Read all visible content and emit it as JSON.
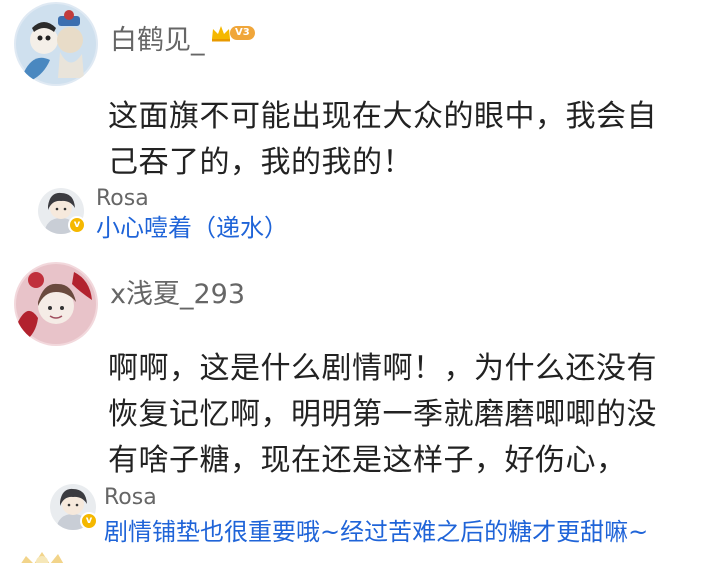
{
  "comments": [
    {
      "username": "白鹤见_",
      "level_badge": "V3",
      "text_lines": [
        "这面旗不可能出现在大众的眼中，我会自",
        "己吞了的，我的我的！"
      ],
      "reply": {
        "username": "Rosa",
        "text": "小心噎着（递水）"
      }
    },
    {
      "username": "x浅夏_293",
      "text_lines": [
        "啊啊，这是什么剧情啊！，为什么还没有",
        "恢复记忆啊，明明第一季就磨磨唧唧的没",
        "有啥子糖，现在还是这样子，好伤心，"
      ],
      "reply": {
        "username": "Rosa",
        "text": "剧情铺垫也很重要哦~经过苦难之后的糖才更甜嘛~"
      }
    }
  ],
  "icons": {
    "crown": "crown-icon",
    "verified": "verified-v-icon"
  },
  "colors": {
    "reply_link": "#1f64d8",
    "username": "#666666",
    "body_text": "#222222",
    "badge_gold": "#f5b800",
    "level_orange": "#f0a63a"
  }
}
